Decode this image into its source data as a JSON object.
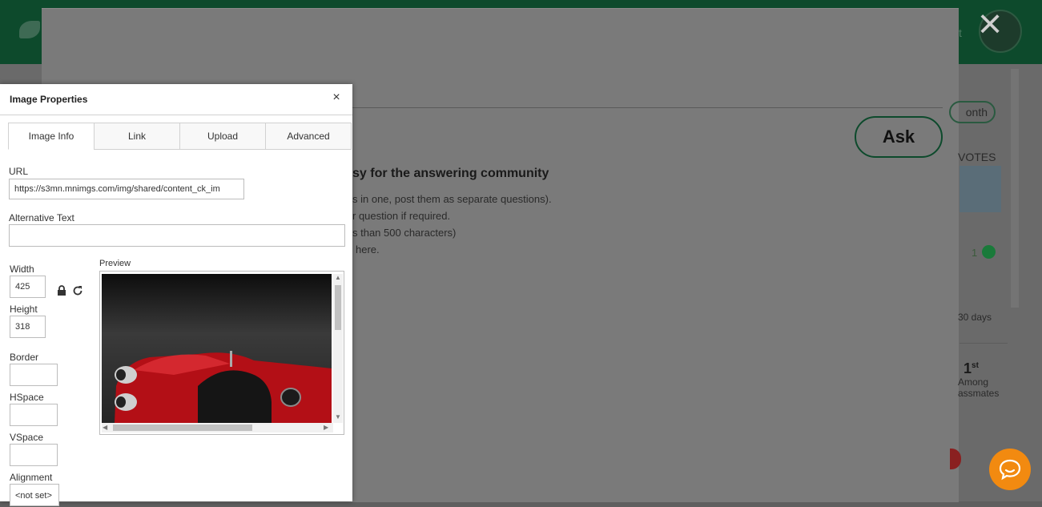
{
  "background": {
    "top_right_text": "t",
    "ask_label": "Ask",
    "tips_title": "sy for the answering community",
    "tips": [
      "s in one, post them as separate questions).",
      "r question if required.",
      "s than 500 characters)",
      "here."
    ],
    "month_label": "onth",
    "votes_label": "VOTES",
    "score": "1",
    "days_label": "30 days",
    "rank_number": "1",
    "rank_suffix": "st",
    "among_label": "Among",
    "classmates_label": "assmates",
    "close_symbol": "×"
  },
  "dialog": {
    "title": "Image Properties",
    "close_symbol": "×",
    "tabs": [
      {
        "label": "Image Info",
        "active": true
      },
      {
        "label": "Link",
        "active": false
      },
      {
        "label": "Upload",
        "active": false
      },
      {
        "label": "Advanced",
        "active": false
      }
    ],
    "url_label": "URL",
    "url_value": "https://s3mn.mnimgs.com/img/shared/content_ck_im",
    "alt_label": "Alternative Text",
    "alt_value": "",
    "width_label": "Width",
    "width_value": "425",
    "height_label": "Height",
    "height_value": "318",
    "border_label": "Border",
    "border_value": "",
    "hspace_label": "HSpace",
    "hspace_value": "",
    "vspace_label": "VSpace",
    "vspace_value": "",
    "alignment_label": "Alignment",
    "alignment_value": "<not set>",
    "preview_label": "Preview",
    "lock_icon": "lock-icon",
    "reset_icon": "reset-size-icon"
  },
  "colors": {
    "topbar": "#0d4a2c",
    "chat_button": "#f28a10",
    "motorcycle": "#c4141a"
  }
}
